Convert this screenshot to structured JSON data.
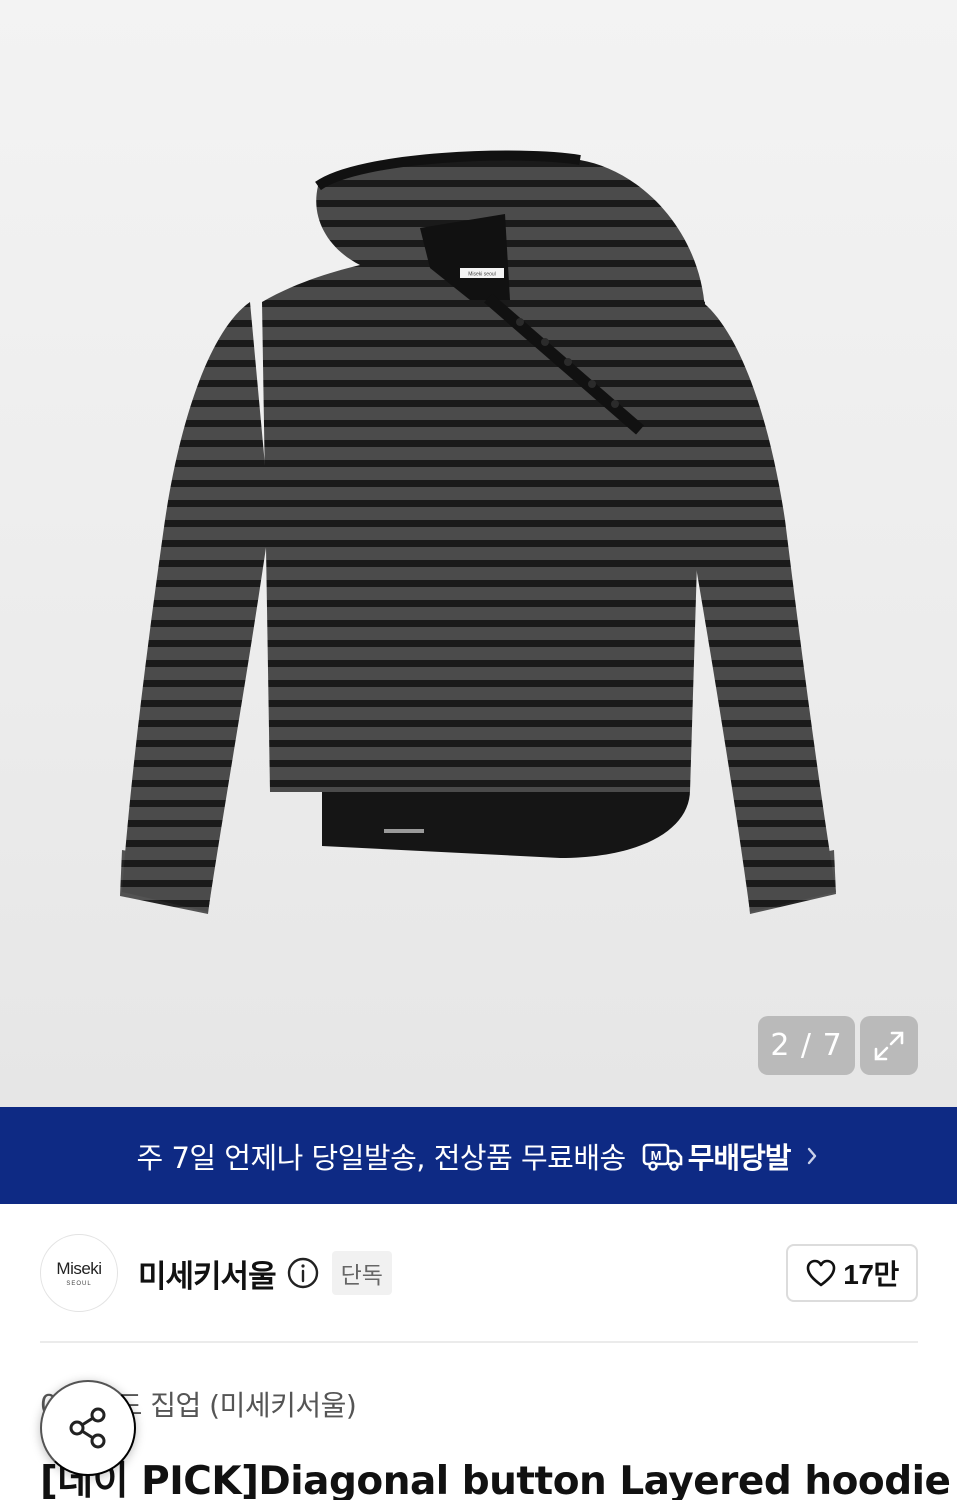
{
  "gallery": {
    "image_alt": "Diagonal button Layered hoodie",
    "garment_tag": "Miseki seoul",
    "counter": "2 / 7"
  },
  "banner": {
    "text": "주 7일 언제나 당일발송, 전상품 무료배송",
    "badge_icon_letter": "M",
    "badge_label": "무배당발"
  },
  "brand": {
    "logo_text": "Miseki",
    "logo_subtext": "SEOUL",
    "name": "미세키서울",
    "exclusive_label": "단독",
    "like_count": "17만"
  },
  "breadcrumb": {
    "first": "0",
    "second": "후드 집업 (미세키서울)"
  },
  "product": {
    "title": "[데이 PICK]Diagonal button Layered hoodie"
  },
  "colors": {
    "banner_bg": "#0e2a84",
    "stripe_dark": "#1a1a1a",
    "stripe_grey": "#4b4b4b"
  },
  "icons": {
    "expand": "expand-icon",
    "truck": "truck-icon",
    "chevron": "chevron-right-icon",
    "info": "info-icon",
    "heart": "heart-icon",
    "share": "share-icon"
  }
}
